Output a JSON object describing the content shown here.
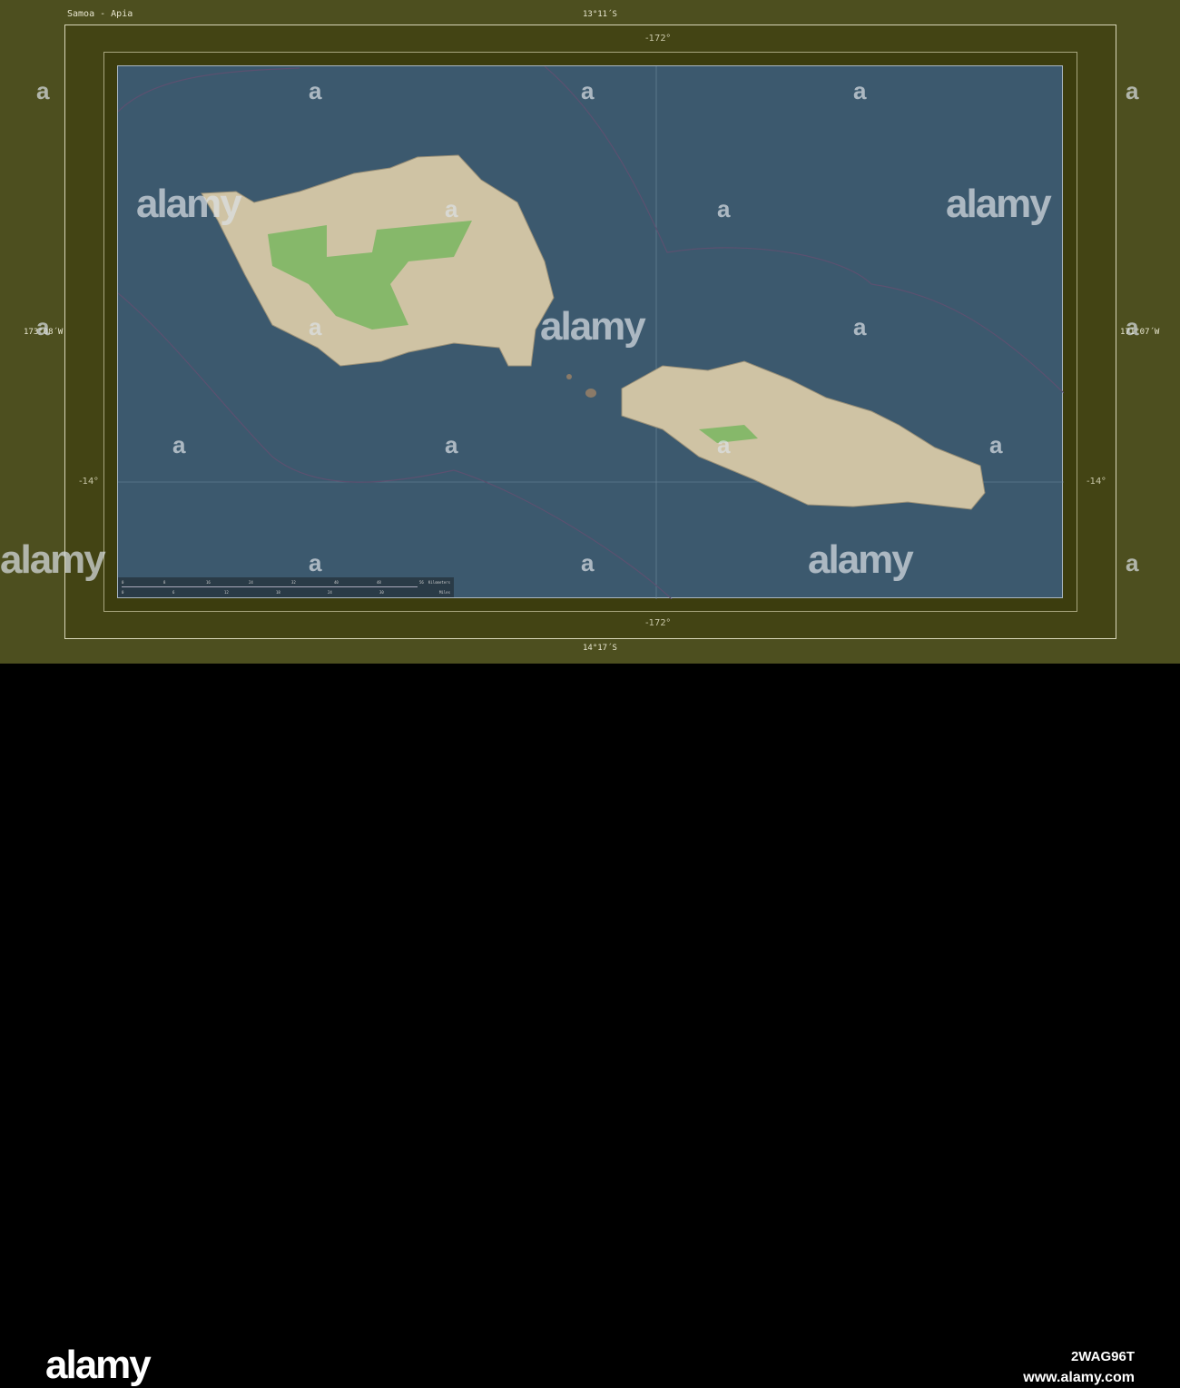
{
  "title": "Samoa - Apia",
  "coords": {
    "top": "13°11´S",
    "bottom": "14°17´S",
    "left": "173°08´W",
    "right": "171°07´W",
    "grid_lon_top": "-172°",
    "grid_lon_bottom": "-172°",
    "grid_lat_left": "-14°",
    "grid_lat_right": "-14°"
  },
  "scale": {
    "km_label": "Kilometers",
    "mi_label": "Miles",
    "km_ticks": [
      "0",
      "8",
      "16",
      "24",
      "32",
      "40",
      "48",
      "56"
    ],
    "mi_ticks": [
      "0",
      "6",
      "12",
      "18",
      "24",
      "30"
    ]
  },
  "watermark": {
    "text": "alamy",
    "letter": "a"
  },
  "footer": {
    "logo": "alamy",
    "image_id": "2WAG96T",
    "url": "www.alamy.com"
  },
  "colors": {
    "sea": "#3c596e",
    "land": "#cfc3a4",
    "park": "#86b86a",
    "frame": "#4d4f1f"
  }
}
